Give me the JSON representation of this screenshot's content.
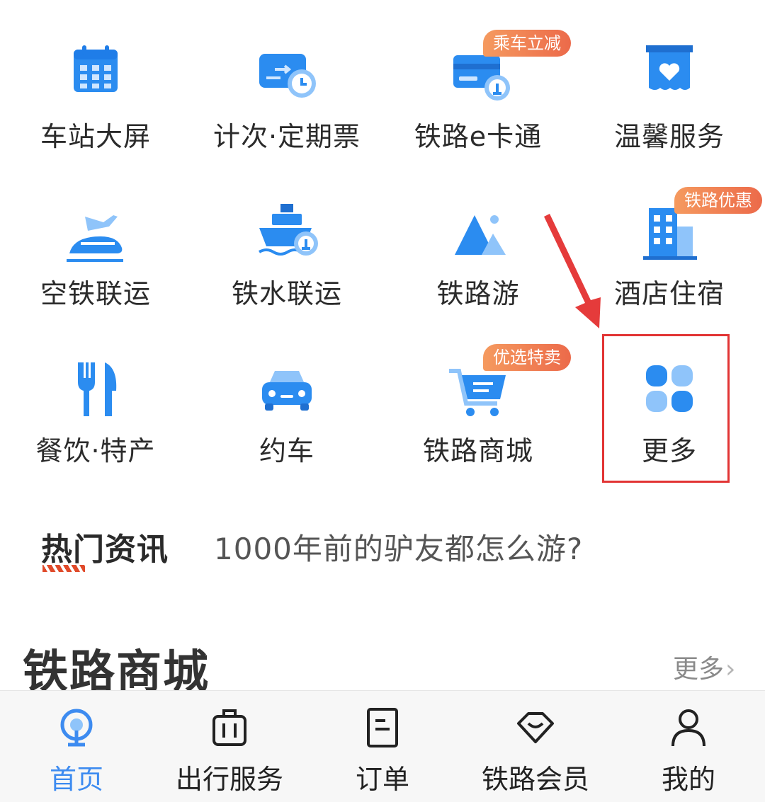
{
  "services": [
    {
      "label": "车站大屏",
      "icon": "station-screen-icon"
    },
    {
      "label": "计次·定期票",
      "icon": "ticket-clock-icon"
    },
    {
      "label": "铁路e卡通",
      "icon": "rail-card-icon",
      "badge": "乘车立减"
    },
    {
      "label": "温馨服务",
      "icon": "heart-service-icon"
    },
    {
      "label": "空铁联运",
      "icon": "air-rail-icon"
    },
    {
      "label": "铁水联运",
      "icon": "ship-rail-icon"
    },
    {
      "label": "铁路游",
      "icon": "mountain-travel-icon"
    },
    {
      "label": "酒店住宿",
      "icon": "hotel-building-icon",
      "badge": "铁路优惠"
    },
    {
      "label": "餐饮·特产",
      "icon": "fork-knife-icon"
    },
    {
      "label": "约车",
      "icon": "car-icon"
    },
    {
      "label": "铁路商城",
      "icon": "shopping-cart-icon",
      "badge": "优选特卖"
    },
    {
      "label": "更多",
      "icon": "more-grid-icon"
    }
  ],
  "news": {
    "tag": "热门资讯",
    "text": "1000年前的驴友都怎么游?"
  },
  "mall": {
    "title": "铁路商城",
    "more": "更多",
    "more_chevron": "›"
  },
  "tabs": [
    {
      "label": "首页",
      "icon": "home-rail-icon",
      "active": true
    },
    {
      "label": "出行服务",
      "icon": "luggage-icon"
    },
    {
      "label": "订单",
      "icon": "order-doc-icon"
    },
    {
      "label": "铁路会员",
      "icon": "diamond-icon"
    },
    {
      "label": "我的",
      "icon": "user-icon"
    }
  ],
  "colors": {
    "accent": "#3d8bf0",
    "icon_blue": "#2b8cf0",
    "icon_light": "#8fc4fa",
    "badge": "#ef7750",
    "highlight": "#e23434",
    "arrow": "#e53b3b"
  }
}
